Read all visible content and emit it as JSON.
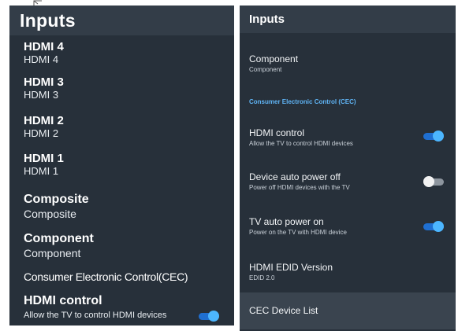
{
  "left": {
    "title": "Inputs",
    "items": [
      {
        "title": "HDMI 4",
        "sub": "HDMI 4"
      },
      {
        "title": "HDMI 3",
        "sub": "HDMI 3"
      },
      {
        "title": "HDMI 2",
        "sub": "HDMI 2"
      },
      {
        "title": "HDMI 1",
        "sub": "HDMI 1"
      },
      {
        "title": "Composite",
        "sub": "Composite"
      },
      {
        "title": "Component",
        "sub": "Component"
      }
    ],
    "cec_label": "Consumer Electronic Control(CEC)",
    "hdmi_control": {
      "title": "HDMI control",
      "sub": "Allow the TV to control HDMI devices",
      "state": "on"
    }
  },
  "right": {
    "title": "Inputs",
    "component": {
      "title": "Component",
      "sub": "Component"
    },
    "section_label": "Consumer Electronic Control (CEC)",
    "settings": [
      {
        "title": "HDMI control",
        "sub": "Allow the TV to control HDMI devices",
        "state": "on"
      },
      {
        "title": "Device auto power off",
        "sub": "Power off HDMI devices with the TV",
        "state": "off"
      },
      {
        "title": "TV auto power on",
        "sub": "Power on the TV with HDMI device",
        "state": "on"
      }
    ],
    "edid": {
      "title": "HDMI EDID Version",
      "sub": "EDID 2.0"
    },
    "cec_list": {
      "title": "CEC Device List"
    }
  },
  "colors": {
    "accent": "#4cb6ff",
    "section": "#5fb4f5",
    "panel": "#27303a",
    "header": "#333d48"
  }
}
